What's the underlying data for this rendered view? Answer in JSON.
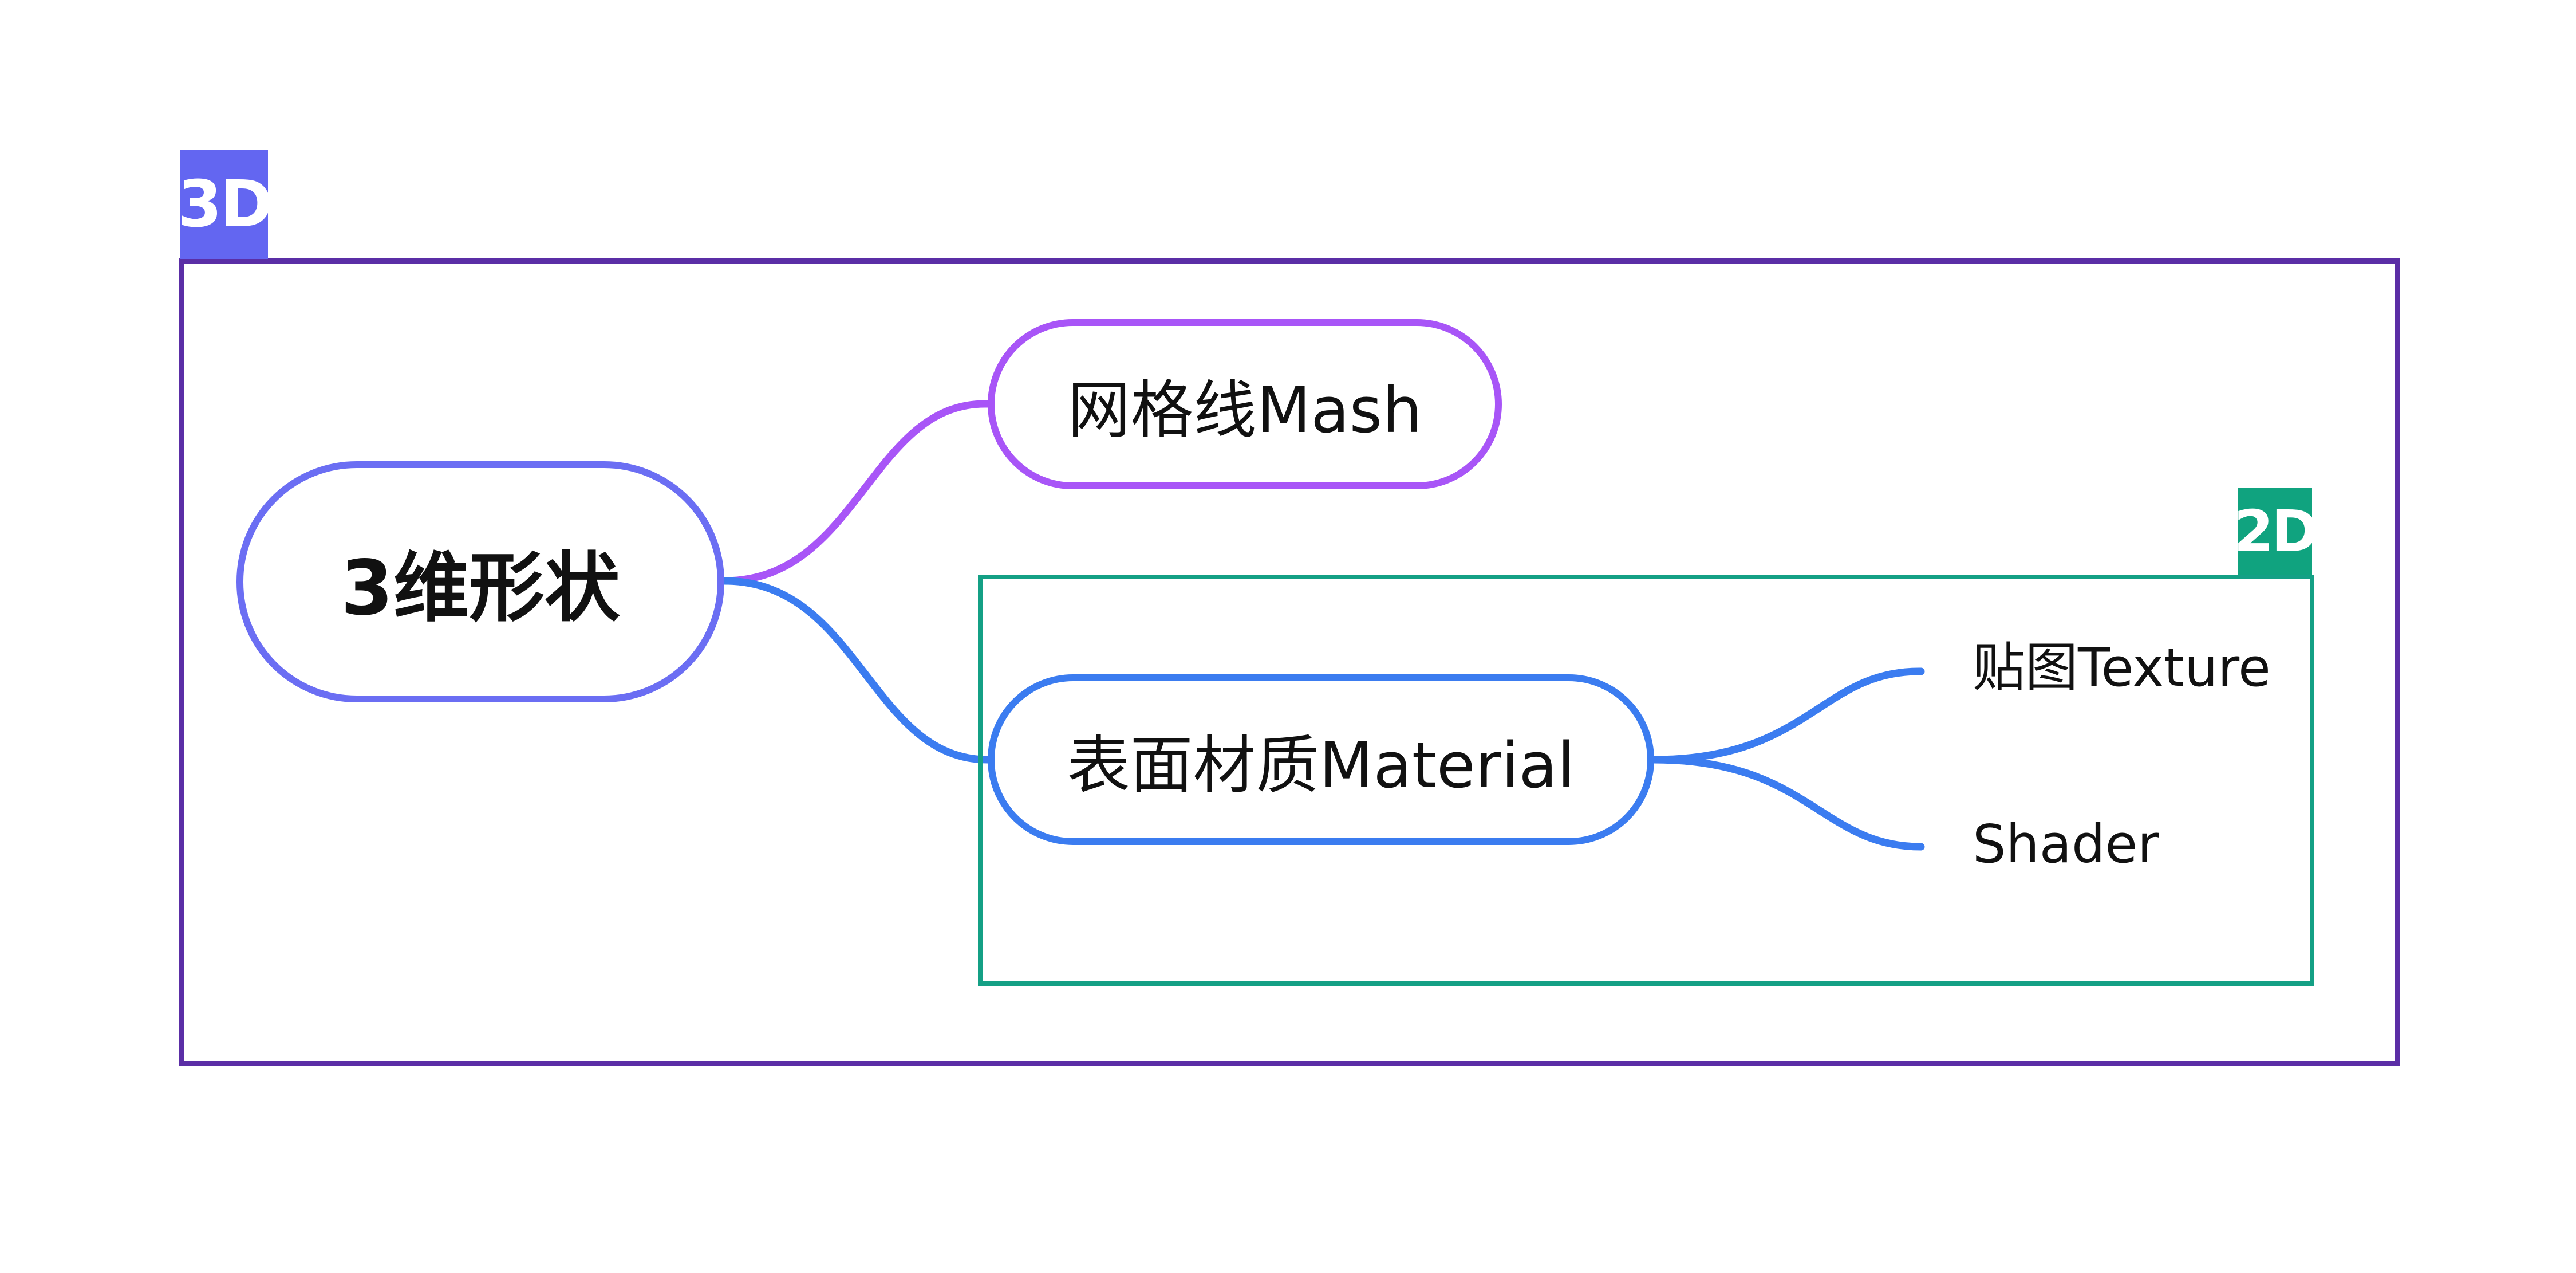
{
  "boundaries": {
    "outer": {
      "label": "3D",
      "color": "#5b2ea6",
      "tag_color": "#6366f1"
    },
    "inner": {
      "label": "2D",
      "color": "#14a085",
      "tag_color": "#10a37f"
    }
  },
  "nodes": {
    "root": {
      "label": "3维形状",
      "color": "#6b6ef3"
    },
    "mesh": {
      "label": "网格线Mash",
      "color": "#a855f7"
    },
    "material": {
      "label": "表面材质Material",
      "color": "#3b7cf0"
    }
  },
  "leaves": {
    "texture": {
      "label": "贴图Texture"
    },
    "shader": {
      "label": "Shader"
    }
  },
  "connectors": {
    "root_to_mesh_color": "#a855f7",
    "root_to_material_color": "#3b7cf0",
    "material_to_leaves_color": "#3b7cf0"
  }
}
